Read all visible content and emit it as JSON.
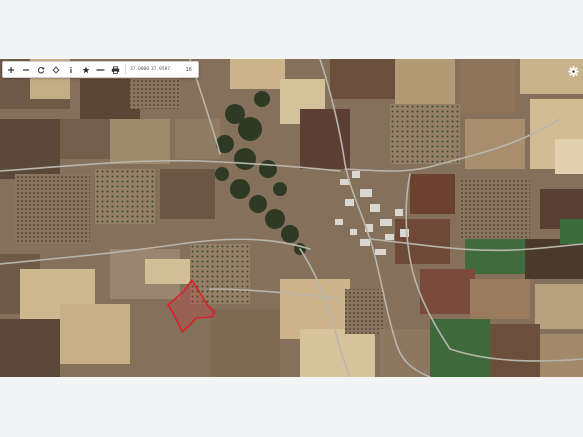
{
  "map": {
    "layer": "satellite",
    "colors": {
      "parcel_outline": "#d9212d",
      "parcel_fill": "rgba(220,40,50,0.22)",
      "road": "#a9a9a0",
      "field_dark": "#5a4636",
      "field_light": "#c9b48c",
      "field_green": "#3f6b3e"
    }
  },
  "toolbar": {
    "zoom_in_icon": "plus-icon",
    "zoom_out_icon": "minus-icon",
    "refresh_icon": "refresh-icon",
    "locate_icon": "crosshair-icon",
    "info_icon": "info-icon",
    "favorite_icon": "star-icon",
    "measure_icon": "ruler-icon",
    "print_icon": "printer-icon",
    "coord_lat": "37.0000",
    "coord_lon": "37.0587",
    "zoom_level": "16"
  },
  "settings": {
    "icon": "gear-icon"
  }
}
